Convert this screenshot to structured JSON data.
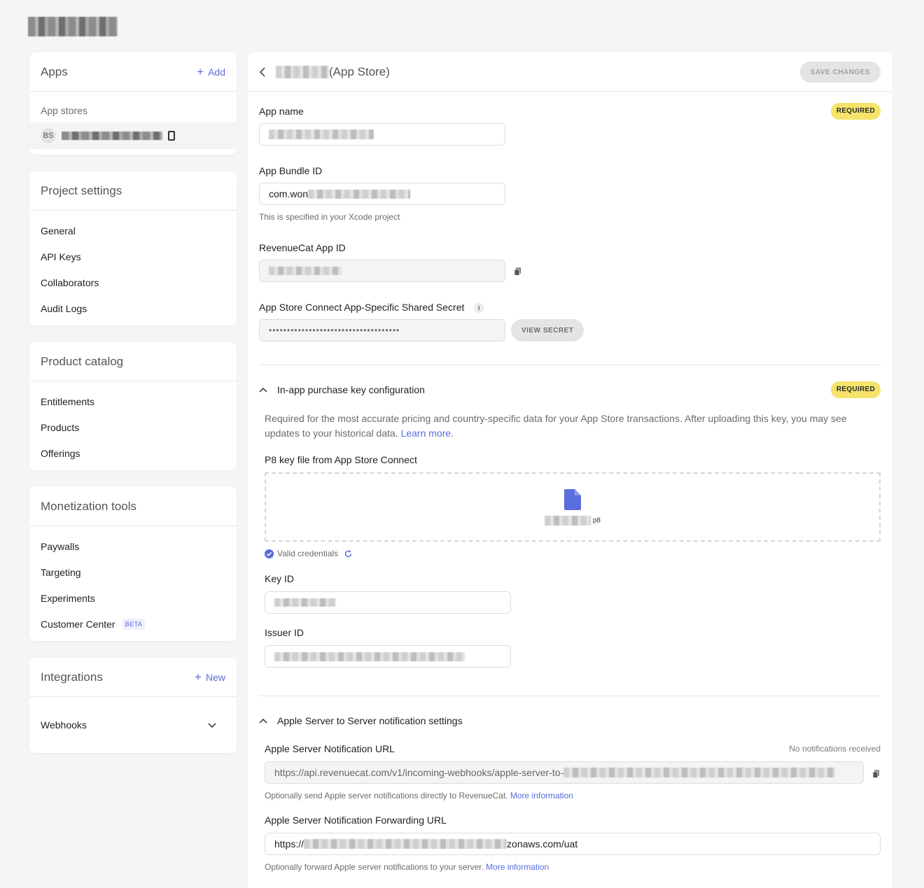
{
  "sidebar": {
    "apps": {
      "title": "Apps",
      "add_label": "Add",
      "subheading": "App stores",
      "app_initials": "BS"
    },
    "project_settings": {
      "title": "Project settings",
      "items": [
        "General",
        "API Keys",
        "Collaborators",
        "Audit Logs"
      ]
    },
    "product_catalog": {
      "title": "Product catalog",
      "items": [
        "Entitlements",
        "Products",
        "Offerings"
      ]
    },
    "monetization": {
      "title": "Monetization tools",
      "items": [
        "Paywalls",
        "Targeting",
        "Experiments",
        "Customer Center"
      ],
      "beta_label": "BETA"
    },
    "integrations": {
      "title": "Integrations",
      "new_label": "New",
      "items": [
        "Webhooks"
      ]
    }
  },
  "main": {
    "title_suffix": "(App Store)",
    "save_label": "SAVE CHANGES",
    "required_label": "REQUIRED",
    "app_name_label": "App name",
    "bundle_id_label": "App Bundle ID",
    "bundle_id_value_prefix": "com.won",
    "bundle_id_help": "This is specified in your Xcode project",
    "rc_app_id_label": "RevenueCat App ID",
    "shared_secret_label": "App Store Connect App-Specific Shared Secret",
    "shared_secret_value": "••••••••••••••••••••••••••••••••••••",
    "view_secret_label": "VIEW SECRET",
    "iap_section_title": "In-app purchase key configuration",
    "iap_description": "Required for the most accurate pricing and country-specific data for your App Store transactions. After uploading this key, you may see updates to your historical data.",
    "learn_more": "Learn more.",
    "p8_label": "P8 key file from App Store Connect",
    "p8_file_ext": "p8",
    "valid_credentials": "Valid credentials",
    "key_id_label": "Key ID",
    "issuer_id_label": "Issuer ID",
    "s2s_section_title": "Apple Server to Server notification settings",
    "notif_url_label": "Apple Server Notification URL",
    "notif_status": "No notifications received",
    "notif_url_prefix": "https://api.revenuecat.com/v1/incoming-webhooks/apple-server-to-",
    "notif_help": "Optionally send Apple server notifications directly to RevenueCat.",
    "more_info": "More information",
    "fwd_url_label": "Apple Server Notification Forwarding URL",
    "fwd_url_prefix": "https://",
    "fwd_url_suffix": "zonaws.com/uat",
    "fwd_help": "Optionally forward Apple server notifications to your server."
  },
  "colors": {
    "accent": "#576cdb",
    "required_badge": "#f5e36a",
    "file_icon": "#5b6ee0"
  }
}
